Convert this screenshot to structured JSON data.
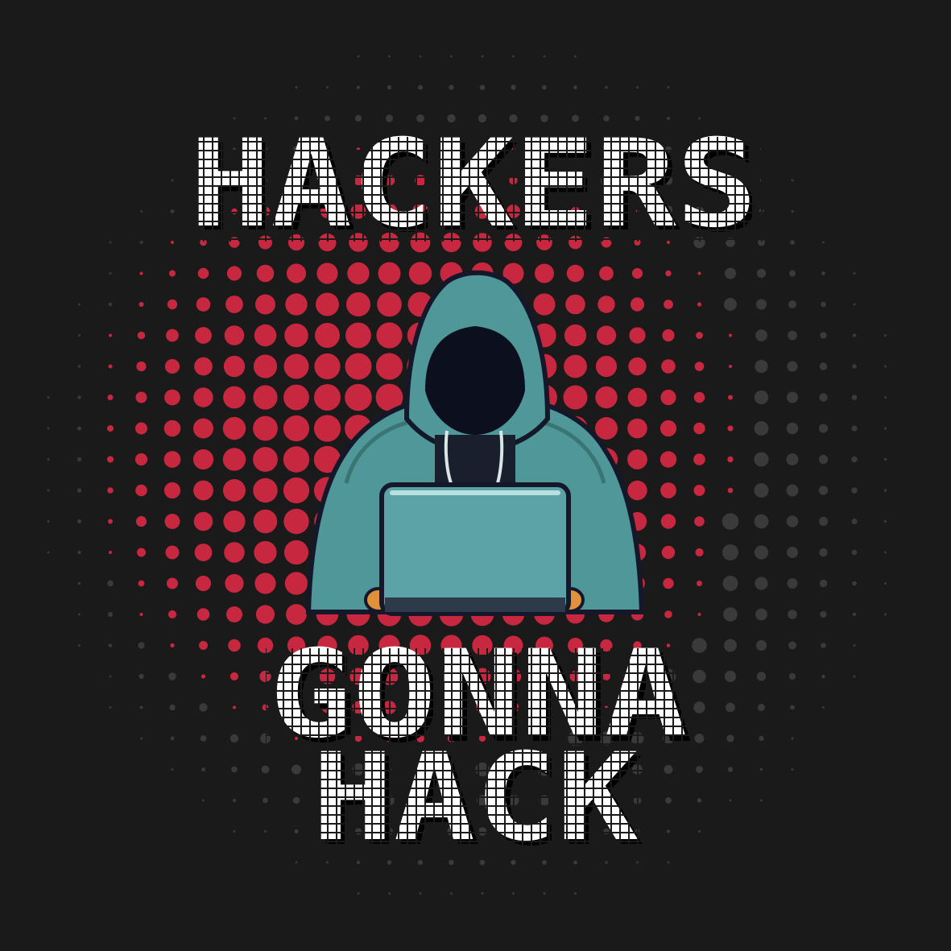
{
  "background_color": "#1a1a1a",
  "colors": {
    "halftone_red": "#c7283f",
    "halftone_gray": "#3a3a3a",
    "text_fill": "#ffffff",
    "text_grid": "#1a1a1a",
    "text_shadow": "#000000",
    "hoodie": "#4f9798",
    "hoodie_dark": "#3a7475",
    "laptop": "#5ba3a6",
    "outline": "#14182a"
  },
  "headline": {
    "line1": "HACKERS",
    "line2": "GONNA",
    "line3": "HACK"
  },
  "illustration": "hooded-hacker-with-laptop"
}
